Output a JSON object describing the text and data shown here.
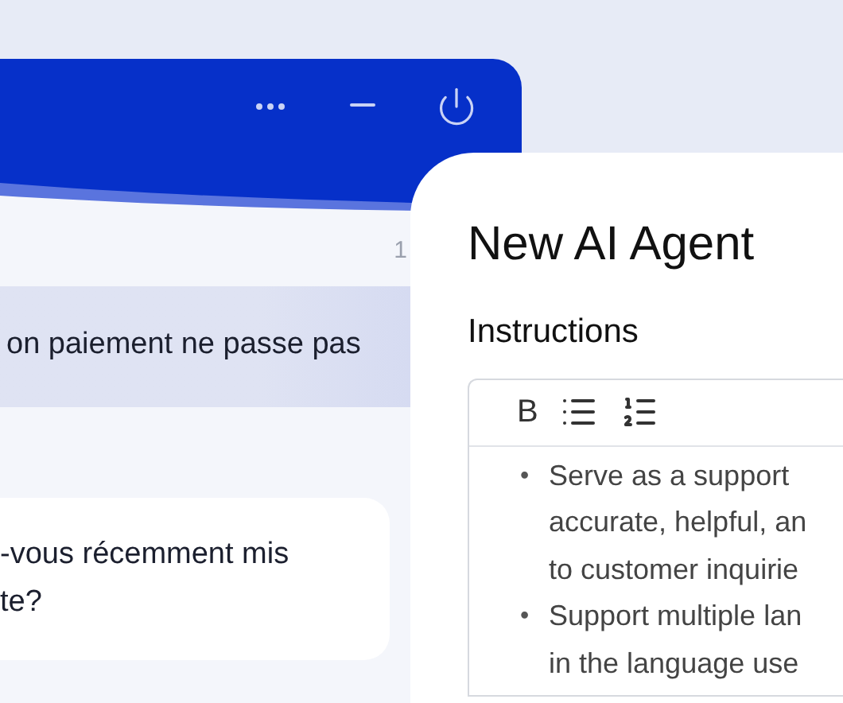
{
  "chat_window": {
    "timestamp": "1",
    "messages": [
      {
        "kind": "user",
        "lines": [
          "on paiement ne passe pas"
        ]
      },
      {
        "kind": "agent",
        "lines": [
          "-vous récemment mis",
          "te?"
        ]
      }
    ]
  },
  "agent_panel": {
    "title": "New AI Agent",
    "section": "Instructions",
    "toolbar": {
      "bold": "B"
    },
    "instructions": [
      {
        "bullet": "•",
        "lines": [
          "Serve as a support",
          "accurate, helpful, an",
          "to customer inquirie"
        ]
      },
      {
        "bullet": "•",
        "lines": [
          "Support multiple lan",
          "in the language use"
        ]
      }
    ]
  }
}
